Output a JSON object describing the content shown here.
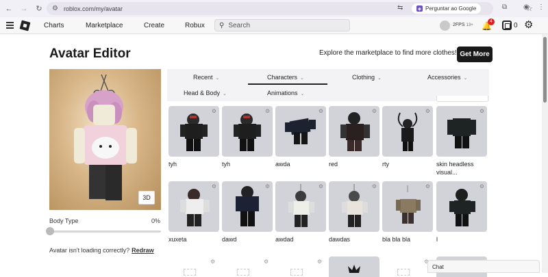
{
  "browser": {
    "url": "roblox.com/my/avatar",
    "ask_google": "Perguntar ao Google"
  },
  "header": {
    "nav": [
      "Charts",
      "Marketplace",
      "Create",
      "Robux"
    ],
    "search_placeholder": "Search",
    "username": "2FPS",
    "age_badge": "13+",
    "notification_count": "4",
    "robux_balance": "0"
  },
  "page": {
    "title": "Avatar Editor",
    "explore_text": "Explore the marketplace to find more clothes!",
    "get_more_label": "Get More",
    "btn_3d": "3D",
    "body_type_label": "Body Type",
    "body_type_value": "0%",
    "body_type_level": 0,
    "loading_text": "Avatar isn't loading correctly?",
    "redraw_label": "Redraw"
  },
  "tabs": [
    {
      "label": "Recent"
    },
    {
      "label": "Characters",
      "active": true
    },
    {
      "label": "Clothing"
    },
    {
      "label": "Accessories"
    },
    {
      "label": "Head & Body"
    },
    {
      "label": "Animations"
    }
  ],
  "characters": [
    {
      "name": "tyh"
    },
    {
      "name": "tyh"
    },
    {
      "name": "awda"
    },
    {
      "name": "red"
    },
    {
      "name": "rty"
    },
    {
      "name": "skin headless visual..."
    },
    {
      "name": "xuxeta"
    },
    {
      "name": "dawd"
    },
    {
      "name": "awdad"
    },
    {
      "name": "dawdas"
    },
    {
      "name": "bla bla bla"
    },
    {
      "name": "l"
    }
  ],
  "chat_label": "Chat",
  "colors": {
    "accent": "#191919",
    "card_bg": "#d2d3d8",
    "badge": "#e02020"
  }
}
